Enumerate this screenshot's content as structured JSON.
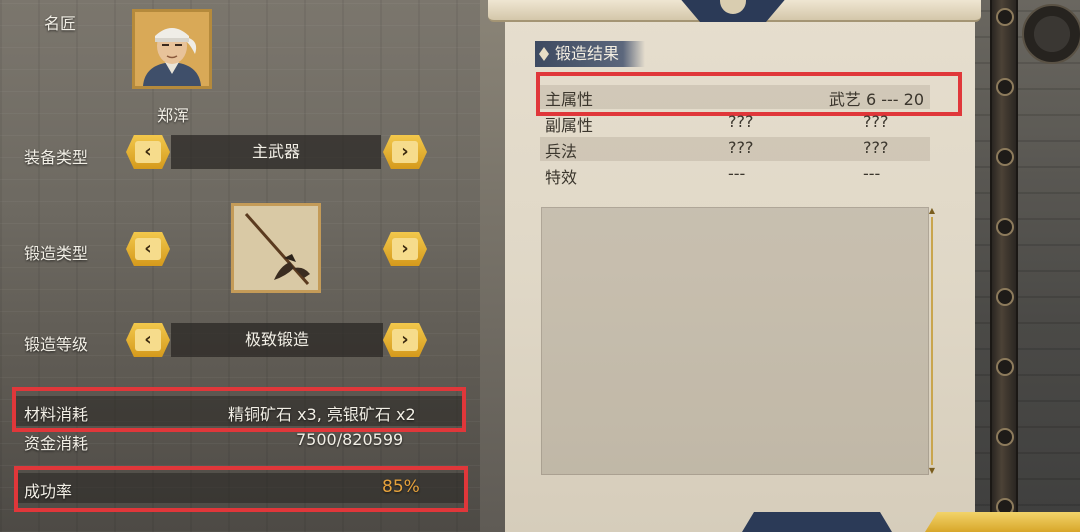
{
  "left": {
    "smith_label": "名匠",
    "smith_name": "郑浑",
    "equip_type": {
      "label": "装备类型",
      "value": "主武器"
    },
    "forge_type": {
      "label": "锻造类型"
    },
    "forge_level": {
      "label": "锻造等级",
      "value": "极致锻造"
    },
    "materials": {
      "label": "材料消耗",
      "value": "精铜矿石 x3, 亮银矿石 x2"
    },
    "gold": {
      "label": "资金消耗",
      "value": "7500/820599"
    },
    "success": {
      "label": "成功率",
      "value": "85%"
    },
    "arrow_left": "‹",
    "arrow_right": "›"
  },
  "result": {
    "title": "锻造结果",
    "rows": [
      {
        "name": "主属性",
        "value": "武艺  6 --- 20"
      },
      {
        "name": "副属性",
        "v1": "???",
        "v2": "???"
      },
      {
        "name": "兵法",
        "v1": "???",
        "v2": "???"
      },
      {
        "name": "特效",
        "v1": "---",
        "v2": "---"
      }
    ],
    "scroll_up": "▲",
    "scroll_down": "▼"
  },
  "colors": {
    "accent_gold": "#e6a23c",
    "highlight_red": "#e0373a",
    "scroll_bg": "#e0d8c7",
    "tab_blue": "#3d4a61"
  }
}
